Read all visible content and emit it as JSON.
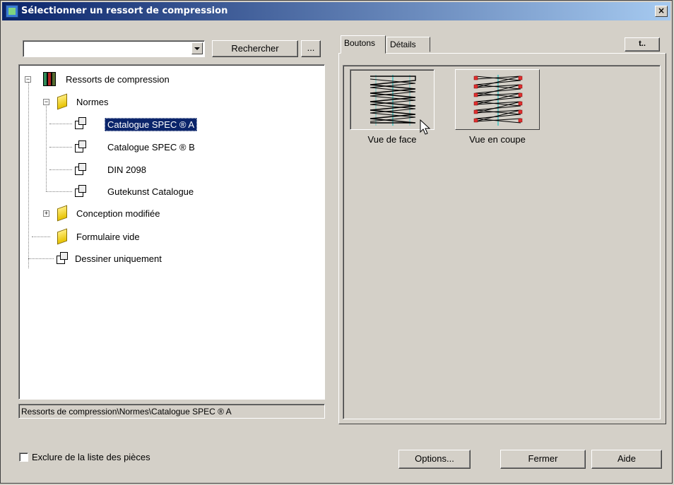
{
  "window": {
    "title": "Sélectionner un ressort de compression",
    "close_label": "×"
  },
  "search": {
    "value": "",
    "button_label": "Rechercher",
    "browse_label": "..."
  },
  "tree": {
    "root": "Ressorts de compression",
    "normes": "Normes",
    "items": [
      "Catalogue SPEC ® A",
      "Catalogue SPEC ® B",
      "DIN 2098",
      "Gutekunst Catalogue"
    ],
    "conception": "Conception modifiée",
    "formulaire": "Formulaire vide",
    "dessiner": "Dessiner uniquement",
    "expander_minus": "−",
    "expander_plus": "+"
  },
  "path": "Ressorts de compression\\Normes\\Catalogue SPEC ® A",
  "tabs": [
    "Boutons",
    "Détails"
  ],
  "up_button_label": "t..",
  "views": [
    {
      "label": "Vue de face",
      "icon": "spring-front-icon"
    },
    {
      "label": "Vue en coupe",
      "icon": "spring-section-icon"
    }
  ],
  "checkbox_label": "Exclure de la liste des pièces",
  "buttons": {
    "options": "Options...",
    "close": "Fermer",
    "help": "Aide"
  },
  "colors": {
    "title_start": "#0a246a",
    "title_end": "#a6caf0",
    "selection": "#0a246a",
    "face": "#d4d0c8"
  }
}
